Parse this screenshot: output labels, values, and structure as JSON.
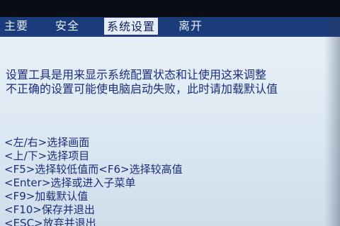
{
  "tabs": [
    {
      "label": "主要"
    },
    {
      "label": "安全"
    },
    {
      "label": "系统设置"
    },
    {
      "label": "离开"
    }
  ],
  "description": [
    "设置工具是用来显示系统配置状态和让使用这来调整",
    "不正确的设置可能使电脑启动失败，此时请加载默认值"
  ],
  "help_items": [
    "<左/右>选择画面",
    "<上/下>选择项目",
    "<F5>选择较低值而<F6>选择较高值",
    "<Enter>选择或进入子菜单",
    "<F9>加载默认值",
    "<F10>保存并退出",
    "<ESC>放弃并退出"
  ],
  "colors": {
    "tabbar": "#1b3c7a",
    "active_tab": "#e5eef7",
    "text": "#1a2d7a",
    "panel": "#dbe7f1"
  }
}
